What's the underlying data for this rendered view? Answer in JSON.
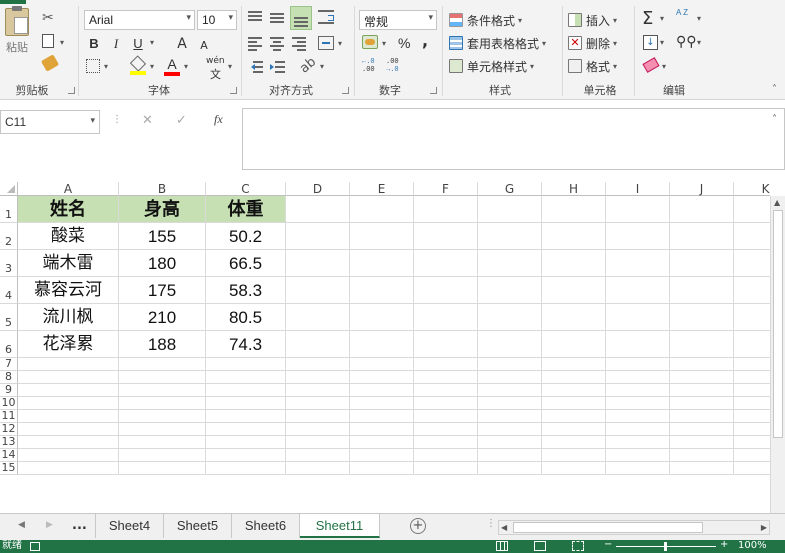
{
  "ribbon": {
    "clipboard": {
      "paste": "粘贴",
      "label": "剪贴板"
    },
    "font": {
      "name": "Arial",
      "size": "10",
      "bold": "B",
      "italic": "I",
      "underline": "U",
      "grow": "A",
      "shrink": "A",
      "phonetic": "wén",
      "label": "字体",
      "fill_color": "#ffff00",
      "font_color": "#ff0000"
    },
    "alignment": {
      "label": "对齐方式"
    },
    "number": {
      "format": "常规",
      "percent": "%",
      "comma": ",",
      "inc_decimal": ".00",
      "dec_decimal": ".00",
      "label": "数字"
    },
    "styles": {
      "conditional": "条件格式",
      "table": "套用表格格式",
      "cell_styles": "单元格样式",
      "label": "样式"
    },
    "cells": {
      "insert": "插入",
      "delete": "删除",
      "format": "格式",
      "label": "单元格"
    },
    "editing": {
      "sum": "Σ",
      "sort": "A Z",
      "find": "查找",
      "label": "编辑"
    }
  },
  "formula_bar": {
    "name_box": "C11",
    "cancel": "✕",
    "enter": "✓",
    "fx": "fx",
    "value": ""
  },
  "columns": [
    "A",
    "B",
    "C",
    "D",
    "E",
    "F",
    "G",
    "H",
    "I",
    "J",
    "K"
  ],
  "rows": [
    "1",
    "2",
    "3",
    "4",
    "5",
    "6",
    "7",
    "8",
    "9",
    "10",
    "11",
    "12",
    "13",
    "14",
    "15"
  ],
  "table": {
    "headers": [
      "姓名",
      "身高",
      "体重"
    ],
    "data": [
      [
        "酸菜",
        "155",
        "50.2"
      ],
      [
        "端木雷",
        "180",
        "66.5"
      ],
      [
        "慕容云河",
        "175",
        "58.3"
      ],
      [
        "流川枫",
        "210",
        "80.5"
      ],
      [
        "花泽累",
        "188",
        "74.3"
      ]
    ],
    "header_fill": "#c6e0b4"
  },
  "sheets": {
    "ellipsis": "...",
    "tabs": [
      "Sheet4",
      "Sheet5",
      "Sheet6",
      "Sheet11"
    ],
    "active": "Sheet11",
    "add": "+"
  },
  "status": {
    "ready": "就绪",
    "zoom": "100%"
  },
  "colors": {
    "excel_green": "#217346"
  }
}
